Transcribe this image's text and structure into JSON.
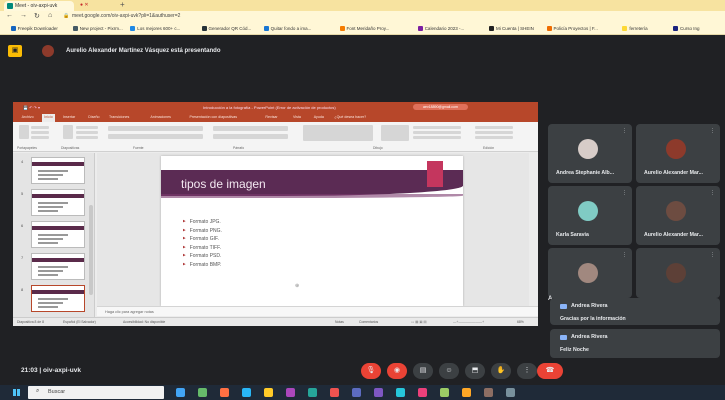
{
  "browser": {
    "tab_title": "Meet - oiv-axpi-uvk",
    "tab_status": "● ✕",
    "url": "meet.google.com/oiv-axpi-uvk?pli=1&authuser=2",
    "bookmarks": [
      {
        "label": "Freepik Downloader",
        "color": "#1565c0"
      },
      {
        "label": "New project - Pixrm...",
        "color": "#455a64"
      },
      {
        "label": "Los mejores 600+ c...",
        "color": "#1e88e5"
      },
      {
        "label": "Generador QR Cód...",
        "color": "#263238"
      },
      {
        "label": "Quitar fondo a ima...",
        "color": "#1976d2"
      },
      {
        "label": "Font Meridaño Proy...",
        "color": "#f57c00"
      },
      {
        "label": "Calendario 2023 -...",
        "color": "#7b1fa2"
      },
      {
        "label": "Mi Cuenta | SHEIN",
        "color": "#212121"
      },
      {
        "label": "Policía Proyectos | F...",
        "color": "#ef6c00"
      },
      {
        "label": "ferretería",
        "color": "#fdd835"
      },
      {
        "label": "Curso Ing",
        "color": "#1a237e"
      }
    ]
  },
  "presenting": {
    "text": "Aurelio Alexander Martínez Vásquez está presentando"
  },
  "ppt": {
    "window_title": "Introducción a la fotografía - PowerPoint (Error de activación de productos)",
    "account": "aev18890@gmail.com",
    "menu": [
      "Archivo",
      "Inicio",
      "Insertar",
      "Diseño",
      "Transiciones",
      "Animaciones",
      "Presentación con diapositivas",
      "Revisar",
      "Vista",
      "Ayuda",
      "¿Qué desea hacer?"
    ],
    "groups": [
      "Portapapeles",
      "Diapositivas",
      "Fuente",
      "Párrafo",
      "Dibujo",
      "Edición"
    ],
    "slide_numbers": [
      "4",
      "5",
      "6",
      "7",
      "8"
    ],
    "slide": {
      "title": "tipos de imagen",
      "items": [
        "Formato JPG.",
        "Formato PNG.",
        "Formato GIF.",
        "Formato TIFF.",
        "Formato PSD.",
        "Formato BMP."
      ]
    },
    "notes_placeholder": "Haga clic para agregar notas",
    "status_left": "Diapositiva 8 de 8",
    "status_lang": "Español (El Salvador)",
    "status_access": "Accesibilidad: No disponible",
    "status_notes": "Notas",
    "status_comments": "Comentarios",
    "zoom": "68%"
  },
  "participants": [
    {
      "name": "Andrea Stephanie Alb...",
      "avatar_color": "#d7ccc8"
    },
    {
      "name": "Aurelio Alexander Mar...",
      "avatar_color": "#8d3a2b"
    },
    {
      "name": "Karla Saravia",
      "avatar_color": "#80cbc4"
    },
    {
      "name": "Aurelio Alexander Mar...",
      "avatar_color": "#6d4c41"
    },
    {
      "name": "",
      "avatar_color": "#a1887f"
    },
    {
      "name": "",
      "avatar_color": "#5d4037"
    }
  ],
  "peek_letter": "A",
  "chat": [
    {
      "from": "Andrea Rivera",
      "message": "Gracias por la información"
    },
    {
      "from": "Andrea Rivera",
      "message": "Feliz Noche"
    }
  ],
  "meeting": {
    "info": "21:03  |  oiv-axpi-uvk"
  },
  "controls": [
    "mic-off",
    "cam-off",
    "captions",
    "emoji",
    "present",
    "hand",
    "more",
    "leave"
  ],
  "taskbar": {
    "search_label": "Buscar"
  }
}
